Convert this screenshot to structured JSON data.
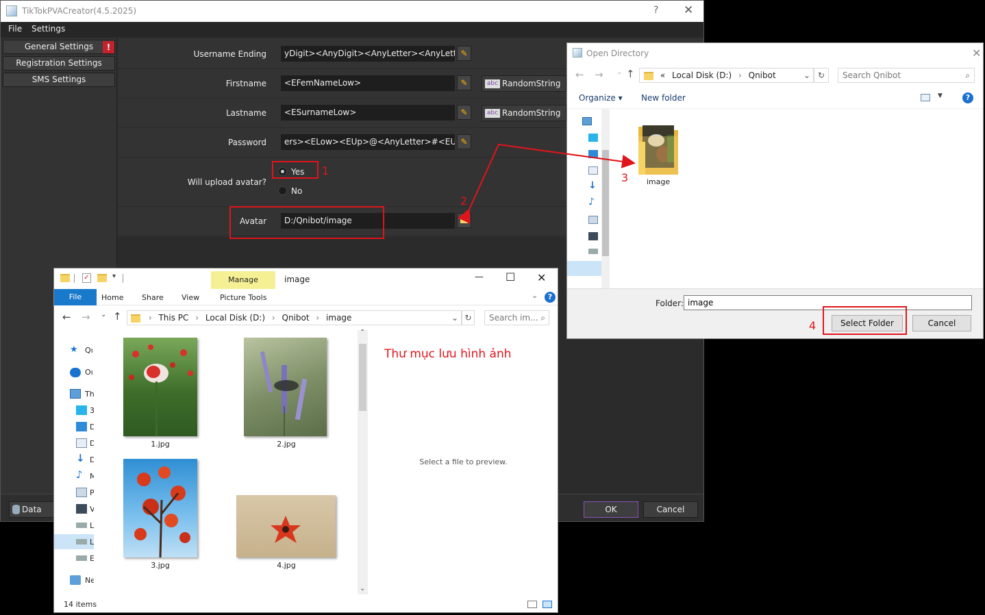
{
  "main": {
    "title": "TikTokPVACreator(4.5.2025)",
    "help": "?",
    "close": "✕",
    "menu": [
      "File",
      "Settings"
    ],
    "nav": [
      {
        "label": "General Settings",
        "warn": "!"
      },
      {
        "label": "Registration Settings"
      },
      {
        "label": "SMS Settings"
      }
    ],
    "fields": {
      "username_ending": {
        "label": "Username Ending",
        "value": "yDigit><AnyDigit><AnyLetter><AnyLetter>"
      },
      "firstname": {
        "label": "Firstname",
        "value": "<EFemNameLow>",
        "random": "RandomString"
      },
      "lastname": {
        "label": "Lastname",
        "value": "<ESurnameLow>",
        "random": "RandomString"
      },
      "password": {
        "label": "Password",
        "value": "ers><ELow><EUp>@<AnyLetter>#<EUp>"
      },
      "avatar_question": "Will upload avatar?",
      "yes": "Yes",
      "no": "No",
      "avatar": {
        "label": "Avatar",
        "value": "D:/Qnibot/image"
      }
    },
    "abc": "abc",
    "edit_icon": "✎",
    "bottom": {
      "data": "Data",
      "ok": "OK",
      "cancel": "Cancel"
    }
  },
  "annotations": {
    "n1": "1",
    "n2": "2",
    "n3": "3",
    "n4": "4",
    "note": "Thư mục lưu hình ảnh",
    "color": "#e0141b"
  },
  "opendir": {
    "title": "Open Directory",
    "close": "✕",
    "path_prefix": "«",
    "path_disk": "Local Disk (D:)",
    "path_sep": "›",
    "path_folder": "Qnibot",
    "search_placeholder": "Search Qnibot",
    "organize": "Organize ▾",
    "new_folder": "New folder",
    "help": "?",
    "folder_item": "image",
    "folder_label": "Folder:",
    "folder_value": "image",
    "select": "Select Folder",
    "cancel": "Cancel"
  },
  "explorer": {
    "title": "image",
    "manage": "Manage",
    "tabs": {
      "file": "File",
      "home": "Home",
      "share": "Share",
      "view": "View",
      "picture_tools": "Picture Tools"
    },
    "breadcrumb": {
      "this_pc": "This PC",
      "disk": "Local Disk (D:)",
      "qnibot": "Qnibot",
      "image": "image",
      "sep": "›"
    },
    "search_placeholder": "Search im...",
    "sidebar": [
      "Qı",
      "Oı",
      "Th",
      "3",
      "D",
      "D",
      "D",
      "M",
      "P",
      "V",
      "L",
      "L",
      "E",
      "Ne"
    ],
    "files": [
      "1.jpg",
      "2.jpg",
      "3.jpg",
      "4.jpg"
    ],
    "preview_text": "Select a file to preview.",
    "status": "14 items",
    "minimize": "—",
    "maximize": "☐",
    "close": "✕"
  }
}
